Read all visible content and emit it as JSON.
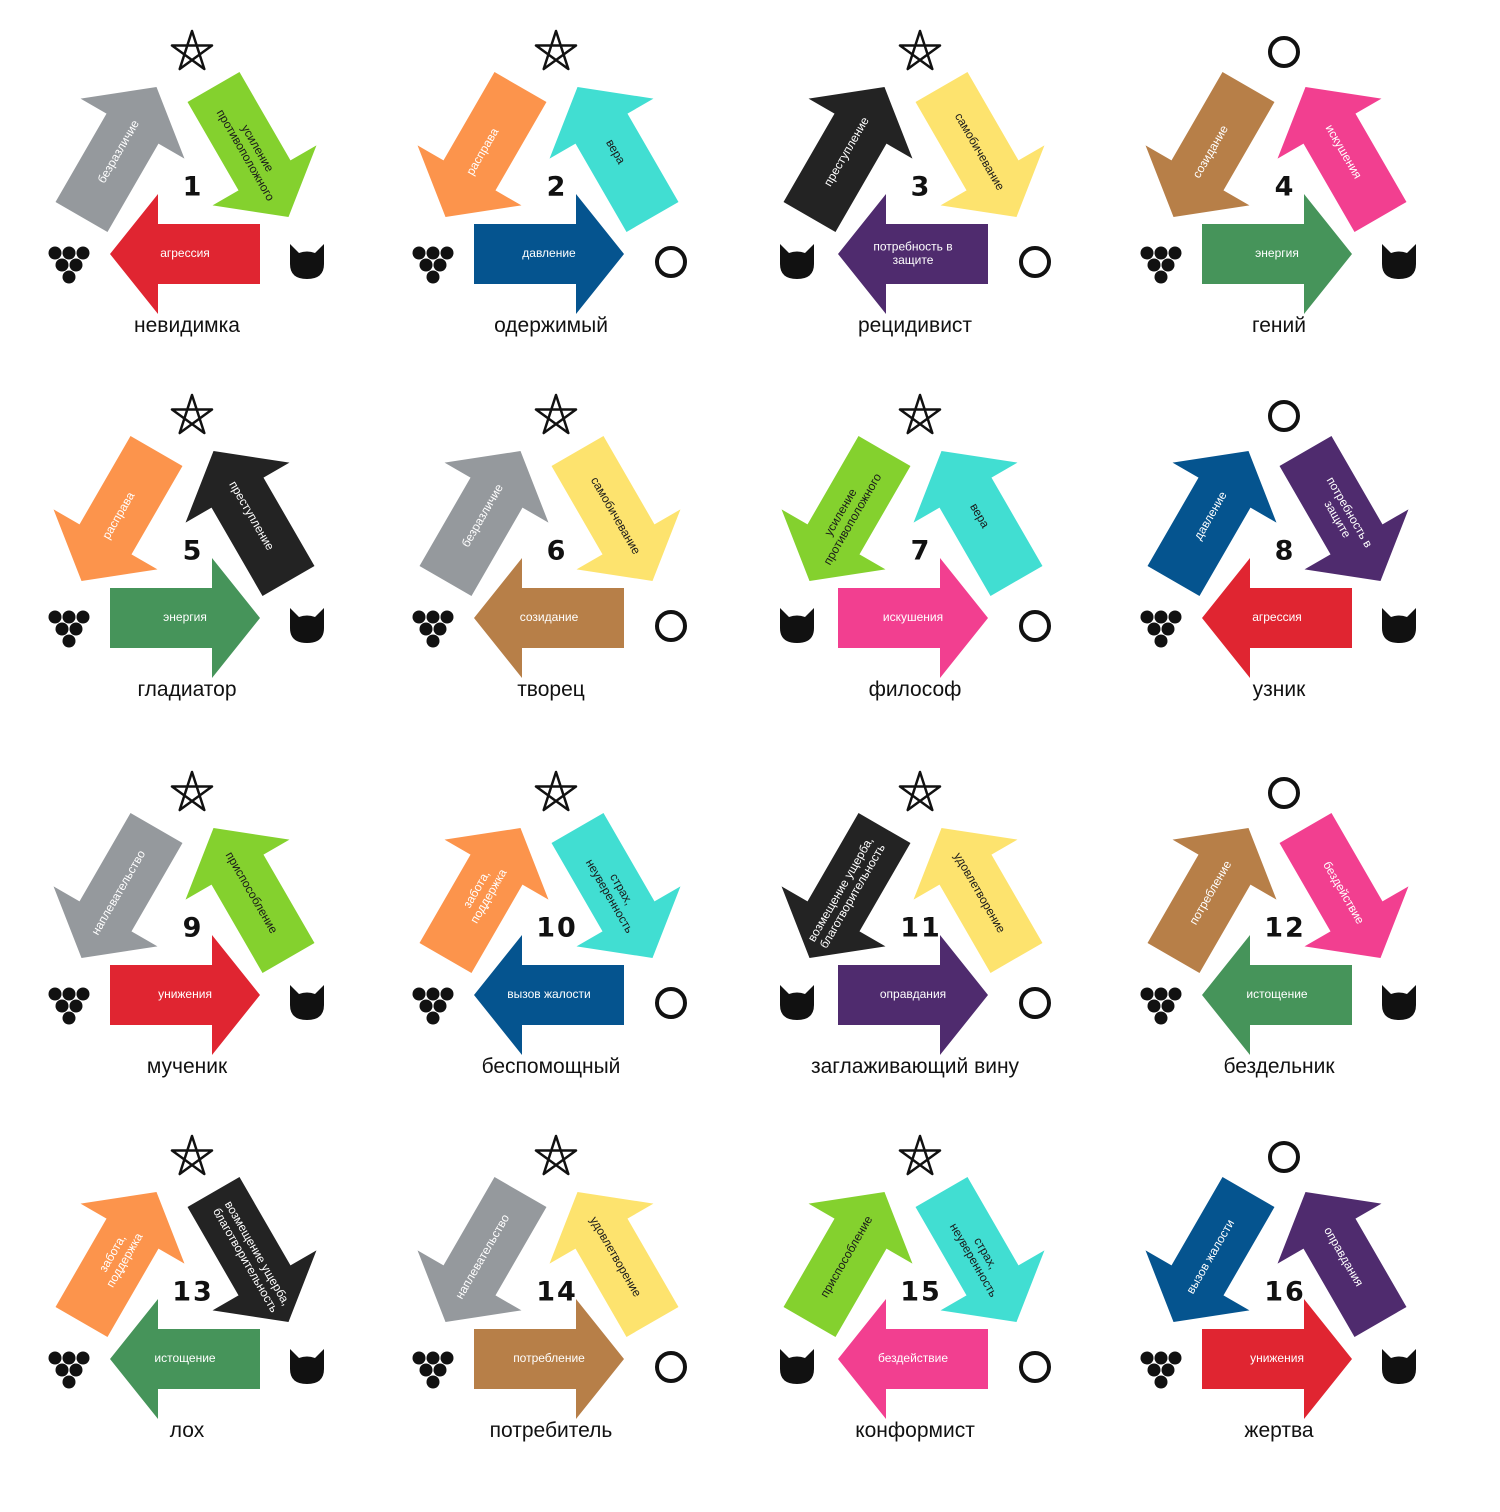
{
  "palette": {
    "gray": "#95999d",
    "lime": "#84d12e",
    "red": "#e02531",
    "orange": "#fc944c",
    "cyan": "#41ded2",
    "blue": "#05548f",
    "black": "#232323",
    "yellow": "#fde36e",
    "purple": "#4f2b6e",
    "brown": "#b77f48",
    "pink": "#f23f90",
    "green": "#46945a"
  },
  "symbols": {
    "star": "pentagram-icon",
    "circle": "ring-icon",
    "cat": "cat-head-icon",
    "grapes": "grapes-icon"
  },
  "cells": [
    {
      "number": "1",
      "name": "невидимка",
      "top": "star",
      "left": "grapes",
      "right": "cat",
      "up": {
        "label": "безразличие",
        "color": "gray",
        "dir": "in"
      },
      "rt": {
        "label": "усиление противоположного",
        "color": "lime",
        "dir": "out"
      },
      "bot": {
        "label": "агрессия",
        "color": "red",
        "dir": "left"
      }
    },
    {
      "number": "2",
      "name": "одержимый",
      "top": "star",
      "left": "grapes",
      "right": "circle",
      "up": {
        "label": "расправа",
        "color": "orange",
        "dir": "out"
      },
      "rt": {
        "label": "вера",
        "color": "cyan",
        "dir": "in"
      },
      "bot": {
        "label": "давление",
        "color": "blue",
        "dir": "right"
      }
    },
    {
      "number": "3",
      "name": "рецидивист",
      "top": "star",
      "left": "cat",
      "right": "circle",
      "up": {
        "label": "преступление",
        "color": "black",
        "dir": "in"
      },
      "rt": {
        "label": "самобичевание",
        "color": "yellow",
        "dir": "out"
      },
      "bot": {
        "label": "потребность в защите",
        "color": "purple",
        "dir": "left"
      }
    },
    {
      "number": "4",
      "name": "гений",
      "top": "circle",
      "left": "grapes",
      "right": "cat",
      "up": {
        "label": "созидание",
        "color": "brown",
        "dir": "out"
      },
      "rt": {
        "label": "искушения",
        "color": "pink",
        "dir": "in"
      },
      "bot": {
        "label": "энергия",
        "color": "green",
        "dir": "right"
      }
    },
    {
      "number": "5",
      "name": "гладиатор",
      "top": "star",
      "left": "grapes",
      "right": "cat",
      "up": {
        "label": "расправа",
        "color": "orange",
        "dir": "out"
      },
      "rt": {
        "label": "преступление",
        "color": "black",
        "dir": "in"
      },
      "bot": {
        "label": "энергия",
        "color": "green",
        "dir": "right"
      }
    },
    {
      "number": "6",
      "name": "творец",
      "top": "star",
      "left": "grapes",
      "right": "circle",
      "up": {
        "label": "безразличие",
        "color": "gray",
        "dir": "in"
      },
      "rt": {
        "label": "самобичевание",
        "color": "yellow",
        "dir": "out"
      },
      "bot": {
        "label": "созидание",
        "color": "brown",
        "dir": "left"
      }
    },
    {
      "number": "7",
      "name": "философ",
      "top": "star",
      "left": "cat",
      "right": "circle",
      "up": {
        "label": "усиление противоположного",
        "color": "lime",
        "dir": "out"
      },
      "rt": {
        "label": "вера",
        "color": "cyan",
        "dir": "in"
      },
      "bot": {
        "label": "искушения",
        "color": "pink",
        "dir": "right"
      }
    },
    {
      "number": "8",
      "name": "узник",
      "top": "circle",
      "left": "grapes",
      "right": "cat",
      "up": {
        "label": "давление",
        "color": "blue",
        "dir": "in"
      },
      "rt": {
        "label": "потребность в защите",
        "color": "purple",
        "dir": "out"
      },
      "bot": {
        "label": "агрессия",
        "color": "red",
        "dir": "left"
      }
    },
    {
      "number": "9",
      "name": "мученик",
      "top": "star",
      "left": "grapes",
      "right": "cat",
      "up": {
        "label": "наплевательство",
        "color": "gray",
        "dir": "out"
      },
      "rt": {
        "label": "приспособление",
        "color": "lime",
        "dir": "in"
      },
      "bot": {
        "label": "унижения",
        "color": "red",
        "dir": "right"
      }
    },
    {
      "number": "10",
      "name": "беспомощный",
      "top": "star",
      "left": "grapes",
      "right": "circle",
      "up": {
        "label": "забота, поддержка",
        "color": "orange",
        "dir": "in"
      },
      "rt": {
        "label": "страх, неуверенность",
        "color": "cyan",
        "dir": "out"
      },
      "bot": {
        "label": "вызов жалости",
        "color": "blue",
        "dir": "left"
      }
    },
    {
      "number": "11",
      "name": "заглаживающий вину",
      "top": "star",
      "left": "cat",
      "right": "circle",
      "up": {
        "label": "возмещение ущерба, благотворительность",
        "color": "black",
        "dir": "out"
      },
      "rt": {
        "label": "удовлетворение",
        "color": "yellow",
        "dir": "in"
      },
      "bot": {
        "label": "оправдания",
        "color": "purple",
        "dir": "right"
      }
    },
    {
      "number": "12",
      "name": "бездельник",
      "top": "circle",
      "left": "grapes",
      "right": "cat",
      "up": {
        "label": "потребление",
        "color": "brown",
        "dir": "in"
      },
      "rt": {
        "label": "бездействие",
        "color": "pink",
        "dir": "out"
      },
      "bot": {
        "label": "истощение",
        "color": "green",
        "dir": "left"
      }
    },
    {
      "number": "13",
      "name": "лох",
      "top": "star",
      "left": "grapes",
      "right": "cat",
      "up": {
        "label": "забота, поддержка",
        "color": "orange",
        "dir": "in"
      },
      "rt": {
        "label": "возмещение ущерба, благотворительность",
        "color": "black",
        "dir": "out"
      },
      "bot": {
        "label": "истощение",
        "color": "green",
        "dir": "left"
      }
    },
    {
      "number": "14",
      "name": "потребитель",
      "top": "star",
      "left": "grapes",
      "right": "circle",
      "up": {
        "label": "наплевательство",
        "color": "gray",
        "dir": "out"
      },
      "rt": {
        "label": "удовлетворение",
        "color": "yellow",
        "dir": "in"
      },
      "bot": {
        "label": "потребление",
        "color": "brown",
        "dir": "right"
      }
    },
    {
      "number": "15",
      "name": "конформист",
      "top": "star",
      "left": "cat",
      "right": "circle",
      "up": {
        "label": "приспособление",
        "color": "lime",
        "dir": "in"
      },
      "rt": {
        "label": "страх, неуверенность",
        "color": "cyan",
        "dir": "out"
      },
      "bot": {
        "label": "бездействие",
        "color": "pink",
        "dir": "left"
      }
    },
    {
      "number": "16",
      "name": "жертва",
      "top": "circle",
      "left": "grapes",
      "right": "cat",
      "up": {
        "label": "вызов жалости",
        "color": "blue",
        "dir": "out"
      },
      "rt": {
        "label": "оправдания",
        "color": "purple",
        "dir": "in"
      },
      "bot": {
        "label": "унижения",
        "color": "red",
        "dir": "right"
      }
    }
  ]
}
